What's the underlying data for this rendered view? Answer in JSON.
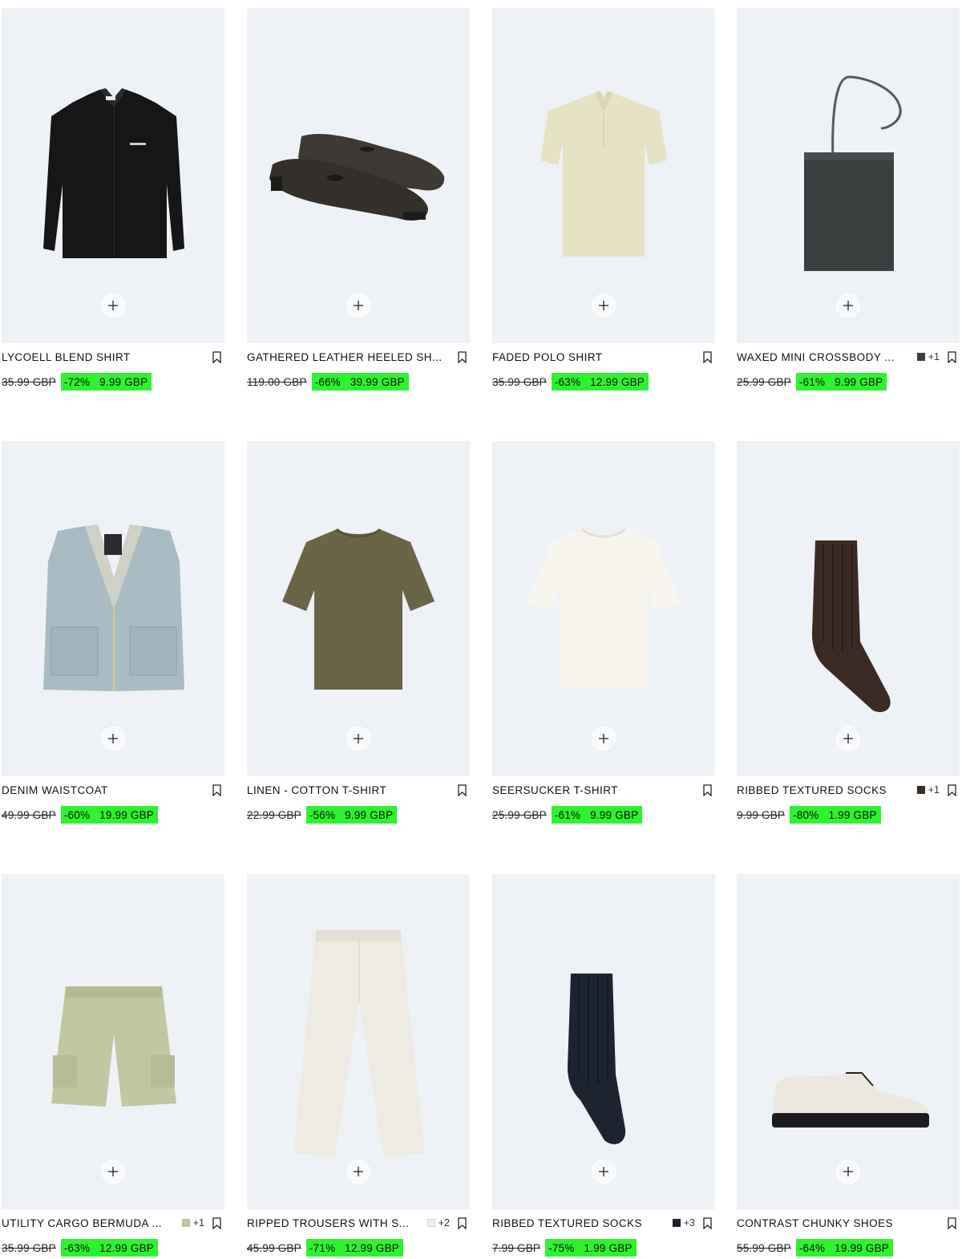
{
  "products": [
    {
      "name": "LYCOELL BLEND SHIRT",
      "old_price": "35.99 GBP",
      "discount": "-72%",
      "price": "9.99 GBP",
      "swatch_color": "",
      "more_colors": "",
      "image": "black-shirt",
      "add_icon": "plus-icon",
      "bookmark_icon": "bookmark-icon"
    },
    {
      "name": "GATHERED LEATHER HEELED SH...",
      "old_price": "119.00 GBP",
      "discount": "-66%",
      "price": "39.99 GBP",
      "swatch_color": "",
      "more_colors": "",
      "image": "brown-leather-shoes",
      "add_icon": "plus-icon",
      "bookmark_icon": "bookmark-icon"
    },
    {
      "name": "FADED POLO SHIRT",
      "old_price": "35.99 GBP",
      "discount": "-63%",
      "price": "12.99 GBP",
      "swatch_color": "",
      "more_colors": "",
      "image": "beige-polo",
      "add_icon": "plus-icon",
      "bookmark_icon": "bookmark-icon"
    },
    {
      "name": "WAXED MINI CROSSBODY ...",
      "old_price": "25.99 GBP",
      "discount": "-61%",
      "price": "9.99 GBP",
      "swatch_color": "#3a3d3e",
      "more_colors": "+1",
      "image": "grey-crossbody-bag",
      "add_icon": "plus-icon",
      "bookmark_icon": "bookmark-icon"
    },
    {
      "name": "DENIM WAISTCOAT",
      "old_price": "49.99 GBP",
      "discount": "-60%",
      "price": "19.99 GBP",
      "swatch_color": "",
      "more_colors": "",
      "image": "denim-vest",
      "add_icon": "plus-icon",
      "bookmark_icon": "bookmark-icon"
    },
    {
      "name": "LINEN - COTTON T-SHIRT",
      "old_price": "22.99 GBP",
      "discount": "-56%",
      "price": "9.99 GBP",
      "swatch_color": "",
      "more_colors": "",
      "image": "khaki-tshirt",
      "add_icon": "plus-icon",
      "bookmark_icon": "bookmark-icon"
    },
    {
      "name": "SEERSUCKER T-SHIRT",
      "old_price": "25.99 GBP",
      "discount": "-61%",
      "price": "9.99 GBP",
      "swatch_color": "",
      "more_colors": "",
      "image": "white-tshirt",
      "add_icon": "plus-icon",
      "bookmark_icon": "bookmark-icon"
    },
    {
      "name": "RIBBED TEXTURED SOCKS",
      "old_price": "9.99 GBP",
      "discount": "-80%",
      "price": "1.99 GBP",
      "swatch_color": "#3b2a26",
      "more_colors": "+1",
      "image": "brown-sock",
      "add_icon": "plus-icon",
      "bookmark_icon": "bookmark-icon"
    },
    {
      "name": "UTILITY CARGO BERMUDA ...",
      "old_price": "35.99 GBP",
      "discount": "-63%",
      "price": "12.99 GBP",
      "swatch_color": "#c3c2a3",
      "more_colors": "+1",
      "image": "green-cargo-shorts",
      "add_icon": "plus-icon",
      "bookmark_icon": "bookmark-icon"
    },
    {
      "name": "RIPPED TROUSERS WITH S...",
      "old_price": "45.99 GBP",
      "discount": "-71%",
      "price": "12.99 GBP",
      "swatch_color": "#f1f1ee",
      "more_colors": "+2",
      "image": "white-trousers",
      "add_icon": "plus-icon",
      "bookmark_icon": "bookmark-icon"
    },
    {
      "name": "RIBBED TEXTURED SOCKS",
      "old_price": "7.99 GBP",
      "discount": "-75%",
      "price": "1.99 GBP",
      "swatch_color": "#1c222b",
      "more_colors": "+3",
      "image": "navy-sock",
      "add_icon": "plus-icon",
      "bookmark_icon": "bookmark-icon"
    },
    {
      "name": "CONTRAST CHUNKY SHOES",
      "old_price": "55.99 GBP",
      "discount": "-64%",
      "price": "19.99 GBP",
      "swatch_color": "",
      "more_colors": "",
      "image": "white-chunky-shoes",
      "add_icon": "plus-icon",
      "bookmark_icon": "bookmark-icon"
    }
  ],
  "colors": {
    "tile_background": "#eef1f5",
    "sale_highlight": "#2ef22e",
    "text": "#111111"
  }
}
